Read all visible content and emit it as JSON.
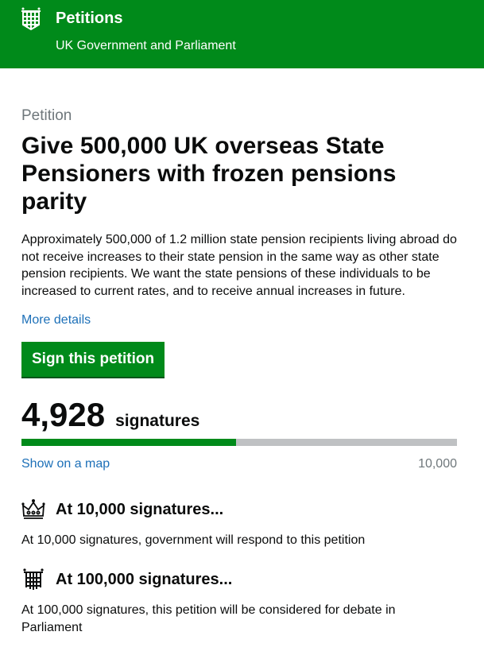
{
  "header": {
    "title": "Petitions",
    "subtitle": "UK Government and Parliament",
    "logo_icon": "portcullis-icon",
    "background": "#008a1a"
  },
  "petition": {
    "caption": "Petition",
    "title": "Give 500,000 UK overseas State Pensioners with frozen pensions parity",
    "summary": "Approximately 500,000 of 1.2 million state pension recipients living abroad do not receive increases to their state pension in the same way as other state pension recipients. We want the state pensions of these individuals to be increased to current rates, and to receive annual increases in future.",
    "more_details": "More details",
    "sign_button": "Sign this petition"
  },
  "signatures": {
    "count": "4,928",
    "label": "signatures",
    "progress_fraction": 0.4928,
    "map_link": "Show on a map",
    "target": "10,000"
  },
  "thresholds": [
    {
      "icon": "crown-icon",
      "title": "At 10,000 signatures...",
      "text": "At 10,000 signatures, government will respond to this petition"
    },
    {
      "icon": "portcullis-icon",
      "title": "At 100,000 signatures...",
      "text": "At 100,000 signatures, this petition will be considered for debate in Parliament"
    }
  ]
}
